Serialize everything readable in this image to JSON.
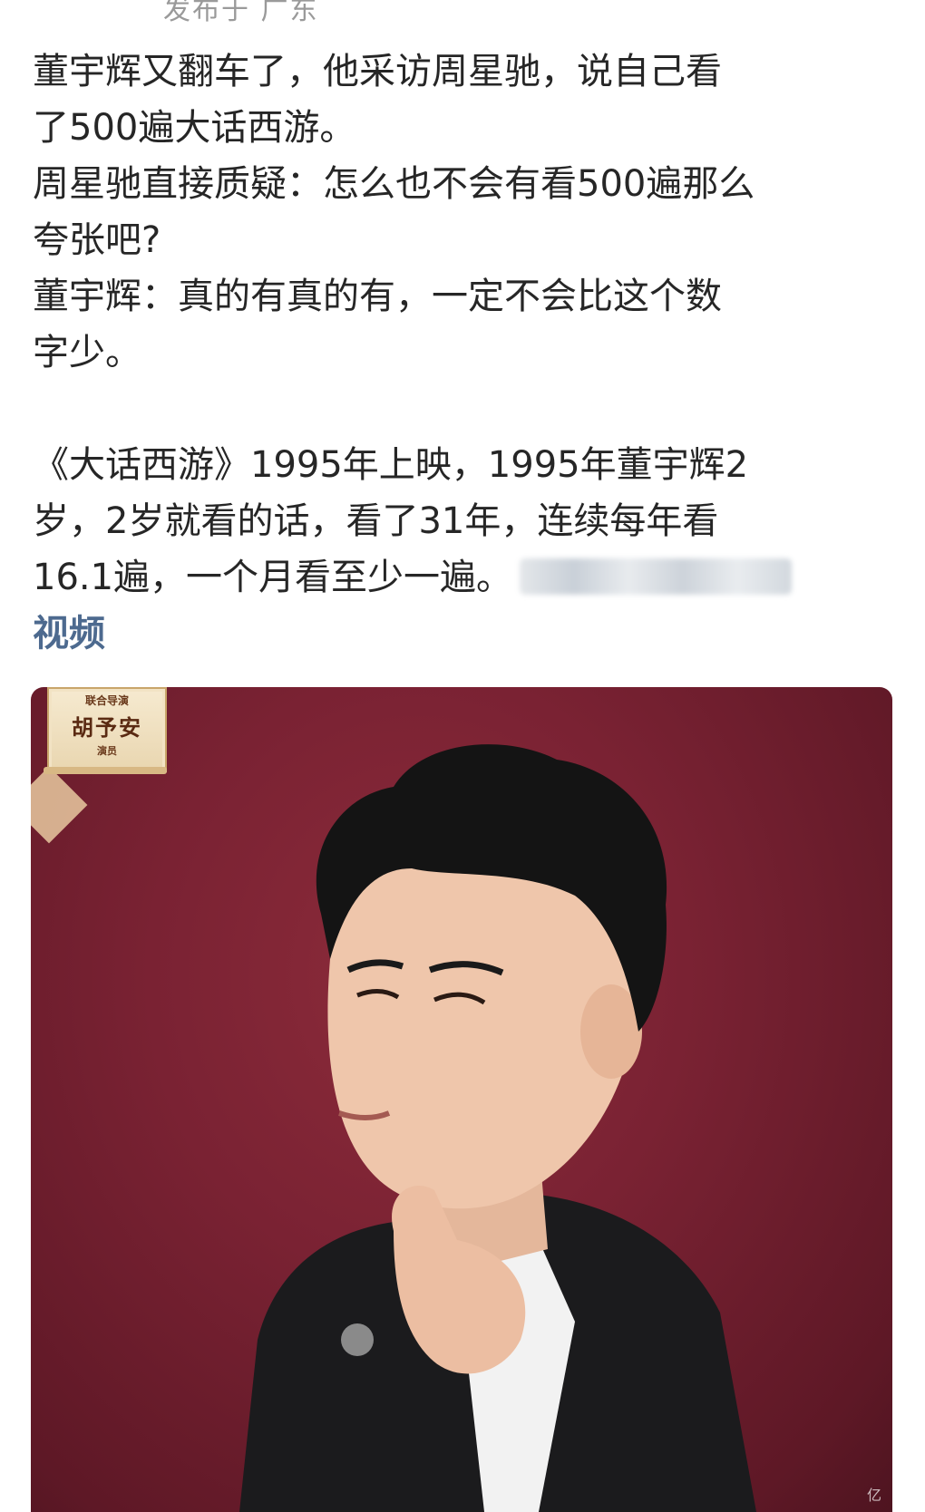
{
  "header": {
    "location_text": "发布于 广东"
  },
  "post": {
    "paragraph1": [
      "董宇辉又翻车了，他采访周星驰，说自己看",
      "了500遍大话西游。",
      "周星驰直接质疑：怎么也不会有看500遍那么",
      "夸张吧?",
      "董宇辉：真的有真的有，一定不会比这个数",
      "字少。"
    ],
    "paragraph2": [
      "《大话西游》1995年上映，1995年董宇辉2",
      "岁，2岁就看的话，看了31年，连续每年看",
      "16.1遍，一个月看至少一遍。"
    ],
    "video_link": "视频"
  },
  "video": {
    "badge_role": "联合导演",
    "badge_name": "胡予安",
    "badge_sub": "演员",
    "watermark": "亿"
  }
}
